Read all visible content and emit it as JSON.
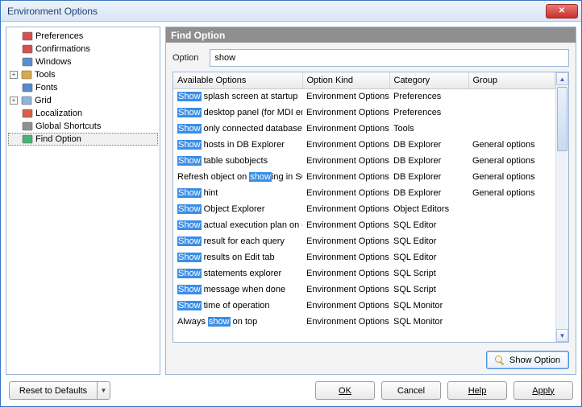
{
  "window": {
    "title": "Environment Options"
  },
  "tree": {
    "items": [
      {
        "label": "Preferences",
        "indent": 12,
        "twisty": null,
        "color": "#c33"
      },
      {
        "label": "Confirmations",
        "indent": 12,
        "twisty": null,
        "color": "#c33"
      },
      {
        "label": "Windows",
        "indent": 12,
        "twisty": null,
        "color": "#3a7ac4"
      },
      {
        "label": "Tools",
        "indent": 0,
        "twisty": "+",
        "color": "#d29a2a"
      },
      {
        "label": "Fonts",
        "indent": 12,
        "twisty": null,
        "color": "#3a76c4"
      },
      {
        "label": "Grid",
        "indent": 0,
        "twisty": "+",
        "color": "#7aa6d6"
      },
      {
        "label": "Localization",
        "indent": 12,
        "twisty": null,
        "color": "#d2432a"
      },
      {
        "label": "Global Shortcuts",
        "indent": 12,
        "twisty": null,
        "color": "#7c7c7c"
      },
      {
        "label": "Find Option",
        "indent": 12,
        "twisty": null,
        "color": "#2aa85a",
        "selected": true
      }
    ]
  },
  "panel": {
    "heading": "Find Option",
    "option_label": "Option",
    "option_value": "show",
    "headers": {
      "c0": "Available Options",
      "c1": "Option Kind",
      "c2": "Category",
      "c3": "Group"
    },
    "rows": [
      {
        "c0": [
          [
            "Show",
            1
          ],
          [
            " splash screen at startup",
            0
          ]
        ],
        "c1": "Environment Options",
        "c2": "Preferences",
        "c3": ""
      },
      {
        "c0": [
          [
            "Show",
            1
          ],
          [
            " desktop panel (for MDI environment sty",
            0
          ]
        ],
        "c1": "Environment Options",
        "c2": "Preferences",
        "c3": ""
      },
      {
        "c0": [
          [
            "Show",
            1
          ],
          [
            " only connected databases",
            0
          ]
        ],
        "c1": "Environment Options",
        "c2": "Tools",
        "c3": ""
      },
      {
        "c0": [
          [
            "Show",
            1
          ],
          [
            " hosts in DB Explorer",
            0
          ]
        ],
        "c1": "Environment Options",
        "c2": "DB Explorer",
        "c3": "General options"
      },
      {
        "c0": [
          [
            "Show",
            1
          ],
          [
            " table subobjects",
            0
          ]
        ],
        "c1": "Environment Options",
        "c2": "DB Explorer",
        "c3": "General options"
      },
      {
        "c0": [
          [
            "Refresh object on ",
            0
          ],
          [
            "show",
            1
          ],
          [
            "ing in SQL",
            0
          ]
        ],
        "c1": "Environment Options",
        "c2": "DB Explorer",
        "c3": "General options"
      },
      {
        "c0": [
          [
            "Show",
            1
          ],
          [
            " hint",
            0
          ]
        ],
        "c1": "Environment Options",
        "c2": "DB Explorer",
        "c3": "General options"
      },
      {
        "c0": [
          [
            "Show",
            1
          ],
          [
            " Object Explorer",
            0
          ]
        ],
        "c1": "Environment Options",
        "c2": "Object Editors",
        "c3": ""
      },
      {
        "c0": [
          [
            "Show",
            1
          ],
          [
            " actual execution plan on q",
            0
          ]
        ],
        "c1": "Environment Options",
        "c2": "SQL Editor",
        "c3": ""
      },
      {
        "c0": [
          [
            "Show",
            1
          ],
          [
            " result for each query",
            0
          ]
        ],
        "c1": "Environment Options",
        "c2": "SQL Editor",
        "c3": ""
      },
      {
        "c0": [
          [
            "Show",
            1
          ],
          [
            " results on Edit tab",
            0
          ]
        ],
        "c1": "Environment Options",
        "c2": "SQL Editor",
        "c3": ""
      },
      {
        "c0": [
          [
            "Show",
            1
          ],
          [
            " statements explorer",
            0
          ]
        ],
        "c1": "Environment Options",
        "c2": "SQL Script",
        "c3": ""
      },
      {
        "c0": [
          [
            "Show",
            1
          ],
          [
            " message when done",
            0
          ]
        ],
        "c1": "Environment Options",
        "c2": "SQL Script",
        "c3": ""
      },
      {
        "c0": [
          [
            "Show",
            1
          ],
          [
            " time of operation",
            0
          ]
        ],
        "c1": "Environment Options",
        "c2": "SQL Monitor",
        "c3": ""
      },
      {
        "c0": [
          [
            "Always ",
            0
          ],
          [
            "show",
            1
          ],
          [
            " on top",
            0
          ]
        ],
        "c1": "Environment Options",
        "c2": "SQL Monitor",
        "c3": ""
      }
    ],
    "show_option_button": "Show Option"
  },
  "footer": {
    "reset": "Reset to Defaults",
    "ok": "OK",
    "cancel": "Cancel",
    "help": "Help",
    "apply": "Apply"
  }
}
